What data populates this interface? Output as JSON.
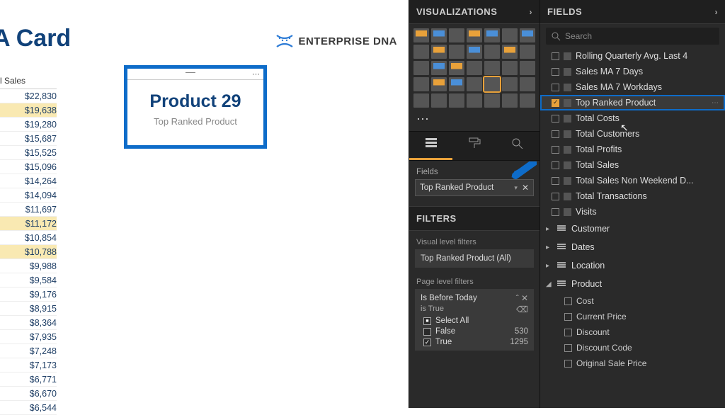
{
  "canvas": {
    "title": "A Card",
    "logo_text": "ENTERPRISE DNA",
    "sales_header": "tal Sales",
    "sales_values": [
      "$22,830",
      "$19,638",
      "$19,280",
      "$15,687",
      "$15,525",
      "$15,096",
      "$14,264",
      "$14,094",
      "$11,697",
      "$11,172",
      "$10,854",
      "$10,788",
      "$9,988",
      "$9,584",
      "$9,176",
      "$8,915",
      "$8,364",
      "$7,935",
      "$7,248",
      "$7,173",
      "$6,771",
      "$6,670",
      "$6,544"
    ],
    "card_value": "Product 29",
    "card_label": "Top Ranked Product"
  },
  "viz": {
    "header": "VISUALIZATIONS",
    "fields_label": "Fields",
    "well_field": "Top Ranked Product",
    "filters_header": "FILTERS",
    "vlf_label": "Visual level filters",
    "vlf_item": "Top Ranked Product (All)",
    "plf_label": "Page level filters",
    "plf_name": "Is Before Today",
    "plf_cond": "is True",
    "plf_selectall": "Select All",
    "plf_false": "False",
    "plf_false_n": "530",
    "plf_true": "True",
    "plf_true_n": "1295"
  },
  "fields": {
    "header": "FIELDS",
    "search_ph": "Search",
    "measures": [
      "Rolling Quarterly Avg. Last 4",
      "Sales MA 7 Days",
      "Sales MA 7 Workdays",
      "Top Ranked Product",
      "Total Costs",
      "Total Customers",
      "Total Profits",
      "Total Sales",
      "Total Sales Non Weekend D...",
      "Total Transactions",
      "Visits"
    ],
    "selected_index": 3,
    "tables": [
      "Customer",
      "Dates",
      "Location",
      "Product"
    ],
    "product_cols": [
      "Cost",
      "Current Price",
      "Discount",
      "Discount Code",
      "Original Sale Price"
    ]
  }
}
